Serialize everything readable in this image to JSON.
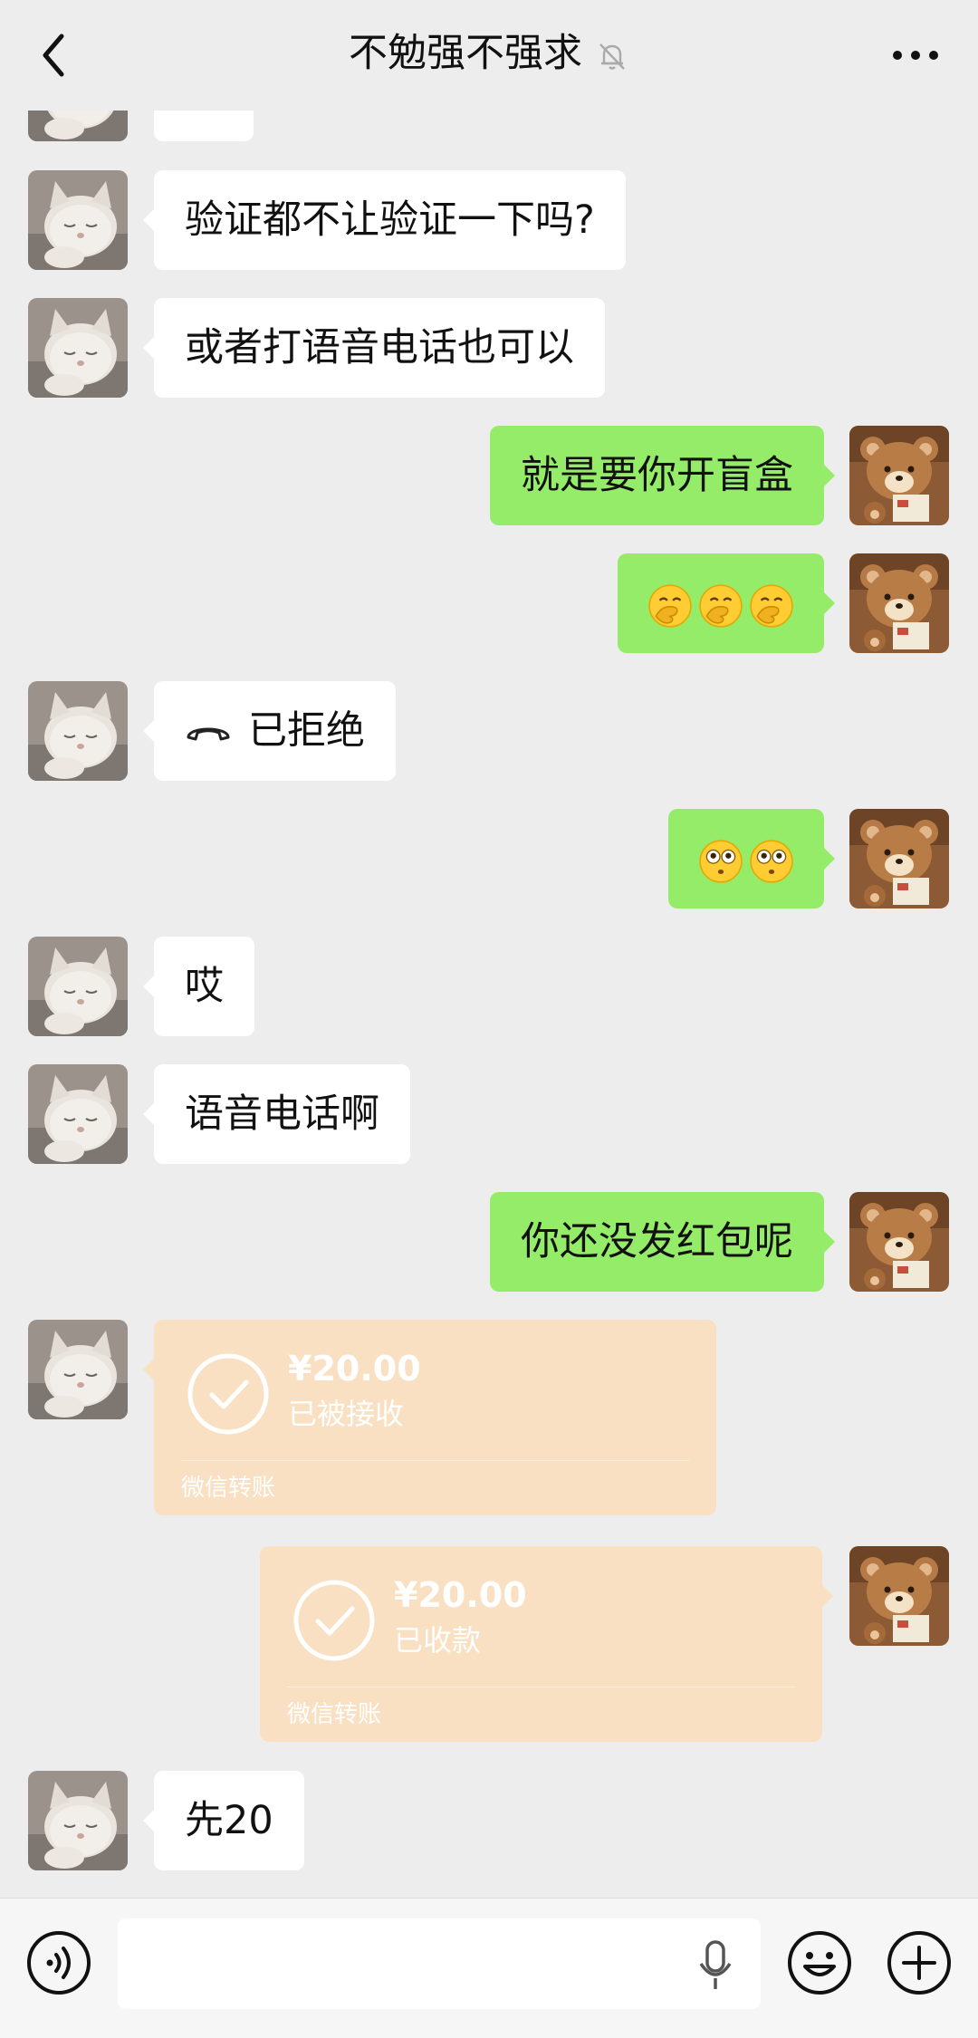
{
  "header": {
    "title": "不勉强不强求",
    "back_icon": "chevron-left-icon",
    "mute_icon": "bell-off-icon",
    "more_icon": "more-dots-icon"
  },
  "colors": {
    "background": "#ededed",
    "outgoing_bubble": "#95ec69",
    "incoming_bubble": "#ffffff",
    "transfer_card": "#fae0c2"
  },
  "messages": [
    {
      "from": "them",
      "type": "text",
      "text": ""
    },
    {
      "from": "them",
      "type": "text",
      "text": "验证都不让验证一下吗?"
    },
    {
      "from": "them",
      "type": "text",
      "text": "或者打语音电话也可以"
    },
    {
      "from": "me",
      "type": "text",
      "text": "就是要你开盲盒"
    },
    {
      "from": "me",
      "type": "emoji",
      "emoji": [
        "face-with-hand-over-mouth",
        "face-with-hand-over-mouth",
        "face-with-hand-over-mouth"
      ]
    },
    {
      "from": "them",
      "type": "call",
      "text": "已拒绝",
      "icon": "phone-hangup-icon"
    },
    {
      "from": "me",
      "type": "emoji",
      "emoji": [
        "flushed-face",
        "flushed-face"
      ]
    },
    {
      "from": "them",
      "type": "text",
      "text": "哎"
    },
    {
      "from": "them",
      "type": "text",
      "text": "语音电话啊"
    },
    {
      "from": "me",
      "type": "text",
      "text": "你还没发红包呢"
    },
    {
      "from": "them",
      "type": "transfer",
      "amount": "¥20.00",
      "status": "已被接收",
      "brand": "微信转账"
    },
    {
      "from": "me",
      "type": "transfer",
      "amount": "¥20.00",
      "status": "已收款",
      "brand": "微信转账"
    },
    {
      "from": "them",
      "type": "text",
      "text": "先20"
    }
  ],
  "input_bar": {
    "placeholder": "",
    "voice_icon": "voice-mode-icon",
    "mic_icon": "microphone-icon",
    "emoji_icon": "smiley-icon",
    "plus_icon": "plus-circle-icon"
  }
}
